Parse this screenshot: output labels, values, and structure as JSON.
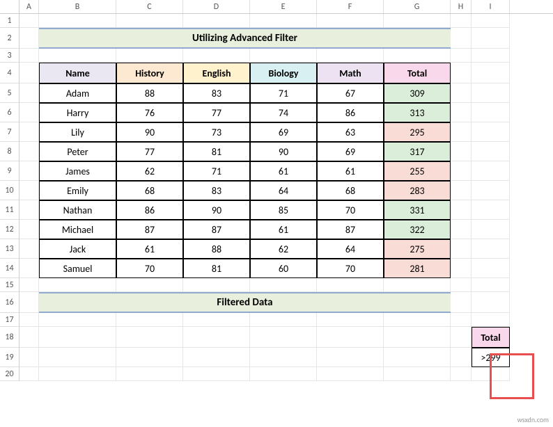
{
  "columns": [
    "A",
    "B",
    "C",
    "D",
    "E",
    "F",
    "G",
    "H",
    "I"
  ],
  "rowNumbers": [
    "1",
    "2",
    "3",
    "4",
    "5",
    "6",
    "7",
    "8",
    "9",
    "10",
    "11",
    "12",
    "13",
    "14",
    "15",
    "16",
    "17",
    "18",
    "19",
    "20"
  ],
  "titleBand": "Utilizing Advanced Filter",
  "filteredBand": "Filtered Data",
  "headers": {
    "name": "Name",
    "history": "History",
    "english": "English",
    "biology": "Biology",
    "math": "Math",
    "total": "Total"
  },
  "rows": [
    {
      "name": "Adam",
      "history": "88",
      "english": "83",
      "biology": "71",
      "math": "67",
      "total": "309",
      "totCls": "tot-green"
    },
    {
      "name": "Harry",
      "history": "76",
      "english": "77",
      "biology": "74",
      "math": "86",
      "total": "313",
      "totCls": "tot-green"
    },
    {
      "name": "Lily",
      "history": "90",
      "english": "73",
      "biology": "69",
      "math": "63",
      "total": "295",
      "totCls": "tot-red"
    },
    {
      "name": "Peter",
      "history": "77",
      "english": "81",
      "biology": "90",
      "math": "69",
      "total": "317",
      "totCls": "tot-green"
    },
    {
      "name": "James",
      "history": "62",
      "english": "71",
      "biology": "61",
      "math": "61",
      "total": "255",
      "totCls": "tot-red"
    },
    {
      "name": "Emily",
      "history": "68",
      "english": "83",
      "biology": "64",
      "math": "68",
      "total": "283",
      "totCls": "tot-red"
    },
    {
      "name": "Nathan",
      "history": "86",
      "english": "90",
      "biology": "85",
      "math": "70",
      "total": "331",
      "totCls": "tot-green"
    },
    {
      "name": "Michael",
      "history": "87",
      "english": "87",
      "biology": "61",
      "math": "87",
      "total": "322",
      "totCls": "tot-green"
    },
    {
      "name": "Jack",
      "history": "61",
      "english": "88",
      "biology": "62",
      "math": "64",
      "total": "275",
      "totCls": "tot-red"
    },
    {
      "name": "Samuel",
      "history": "70",
      "english": "81",
      "biology": "60",
      "math": "70",
      "total": "281",
      "totCls": "tot-red"
    }
  ],
  "criteria": {
    "header": "Total",
    "value": ">299"
  },
  "watermark": "wsxdn.com"
}
